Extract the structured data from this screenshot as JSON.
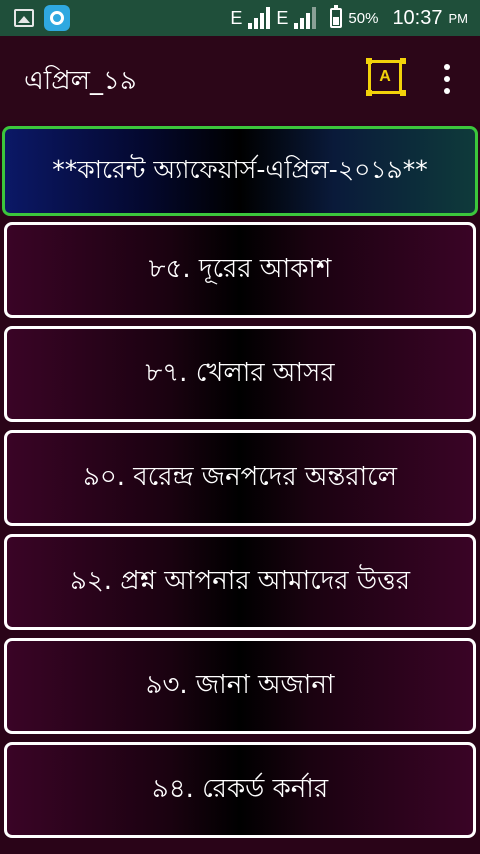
{
  "status_bar": {
    "network_1": "E",
    "network_2": "E",
    "battery_pct": "50%",
    "time": "10:37",
    "ampm": "PM"
  },
  "app_bar": {
    "title": "এপ্রিল_১৯",
    "font_button_label": "A"
  },
  "list": {
    "header": "**কারেন্ট অ্যাফেয়ার্স-এপ্রিল-২০১৯**",
    "items": [
      "৮৫. দূরের আকাশ",
      "৮৭. খেলার আসর",
      "৯০. বরেন্দ্র জনপদের অন্তরালে",
      "৯২. প্রশ্ন আপনার আমাদের উত্তর",
      "৯৩. জানা অজানা",
      "৯৪. রেকর্ড কর্নার"
    ]
  },
  "colors": {
    "status_bar_bg": "#1f4f3a",
    "app_bar_bg": "#2c0618",
    "page_bg": "#2a0418",
    "header_border": "#3cc63c",
    "item_border": "#ffffff",
    "accent_icon": "#f2d20a"
  },
  "icons": {
    "status_left": [
      "gallery-icon",
      "app-sync-icon"
    ],
    "app_bar": [
      "font-size-icon",
      "more-vert-icon"
    ]
  }
}
